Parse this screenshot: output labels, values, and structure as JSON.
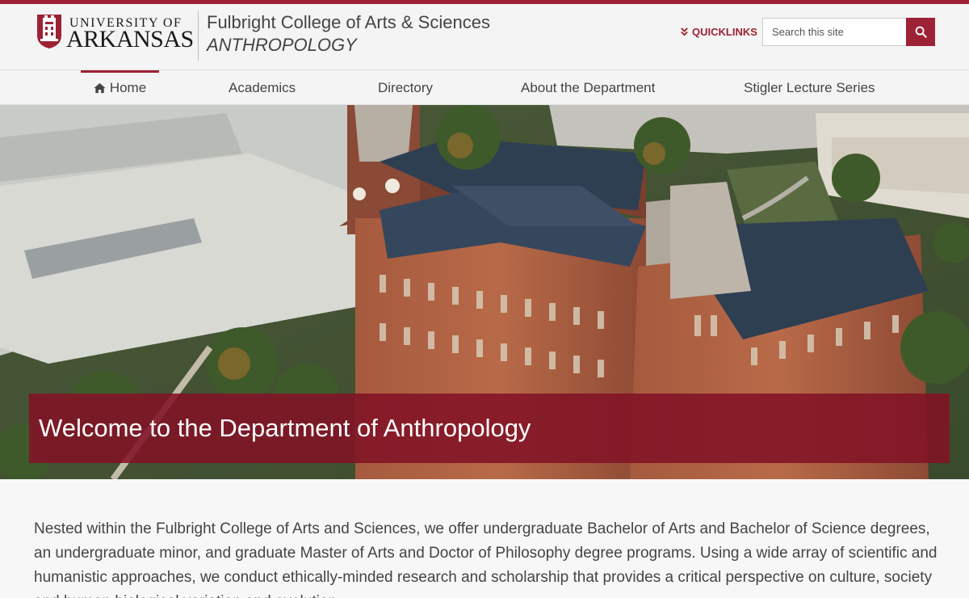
{
  "university": {
    "word_top": "UNIVERSITY OF",
    "word_bottom": "ARKANSAS",
    "seal_icon": "old-main-seal-icon"
  },
  "college": {
    "name": "Fulbright College of Arts & Sciences",
    "department": "ANTHROPOLOGY"
  },
  "quicklinks": {
    "label": "QUICKLINKS",
    "icon": "double-chevron-down-icon"
  },
  "search": {
    "placeholder": "Search this site",
    "icon": "search-icon"
  },
  "nav": {
    "items": [
      {
        "label": "Home",
        "icon": "home-icon",
        "active": true
      },
      {
        "label": "Academics"
      },
      {
        "label": "Directory"
      },
      {
        "label": "About the Department"
      },
      {
        "label": "Stigler Lecture Series"
      }
    ]
  },
  "hero": {
    "title": "Welcome to the Department of Anthropology"
  },
  "intro": {
    "text": "Nested within the Fulbright College of Arts and Sciences, we offer undergraduate Bachelor of Arts and Bachelor of Science degrees, an undergraduate minor, and graduate Master of Arts and Doctor of Philosophy degree programs. Using a wide array of scientific and humanistic approaches, we conduct ethically-minded research and scholarship that provides a critical perspective on culture, society and human biological variation and evolution."
  },
  "colors": {
    "brand": "#9d2235",
    "banner": "#821226",
    "background": "#f4f4f4",
    "text": "#444444"
  }
}
